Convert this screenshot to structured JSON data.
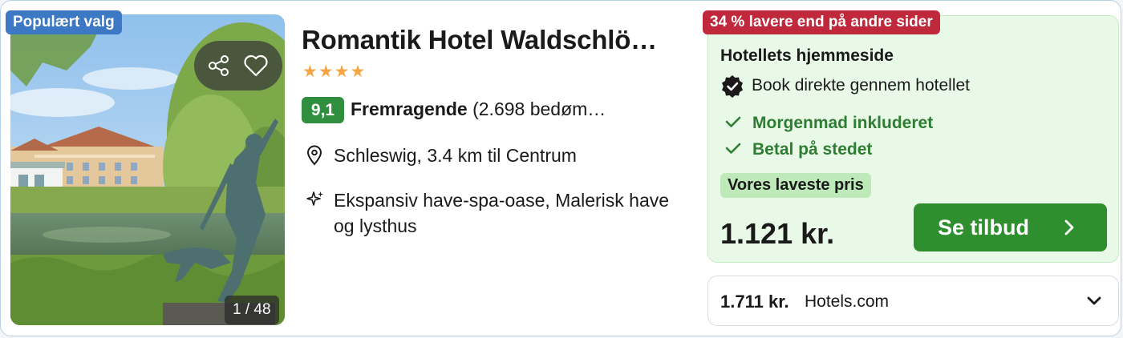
{
  "hotel": {
    "badge": "Populært valg",
    "photo_counter": "1 / 48",
    "name": "Romantik Hotel Waldschlö…",
    "stars": "★★★★",
    "star_count": 4,
    "score": "9,1",
    "rating_label": "Fremragende",
    "reviews": "(2.698 bedøm…",
    "location": "Schleswig, 3.4 km til Centrum",
    "feature": "Ekspansiv have-spa-oase, Malerisk have og lysthus"
  },
  "offer": {
    "discount": "34 % lavere end på andre sider",
    "provider": "Hotellets hjemmeside",
    "direct": "Book direkte gennem hotellet",
    "perks": [
      "Morgenmad inkluderet",
      "Betal på stedet"
    ],
    "lowest_badge": "Vores laveste pris",
    "price": "1.121 kr.",
    "cta": "Se tilbud"
  },
  "alternative": {
    "price": "1.711 kr.",
    "site": "Hotels.com"
  },
  "icons": {
    "share": "share-icon",
    "favorite": "heart-icon",
    "location": "map-pin-icon",
    "feature": "sparkle-icon",
    "verified": "verified-badge-icon",
    "check": "check-icon",
    "cta": "chevron-right-icon",
    "expand": "chevron-down-icon"
  },
  "colors": {
    "badge_blue": "#3d78c5",
    "discount_red": "#c0283b",
    "score_green": "#2f8f3e",
    "cta_green": "#2f8f2f",
    "offer_bg": "#e9f9e8",
    "stars": "#f5a542"
  }
}
